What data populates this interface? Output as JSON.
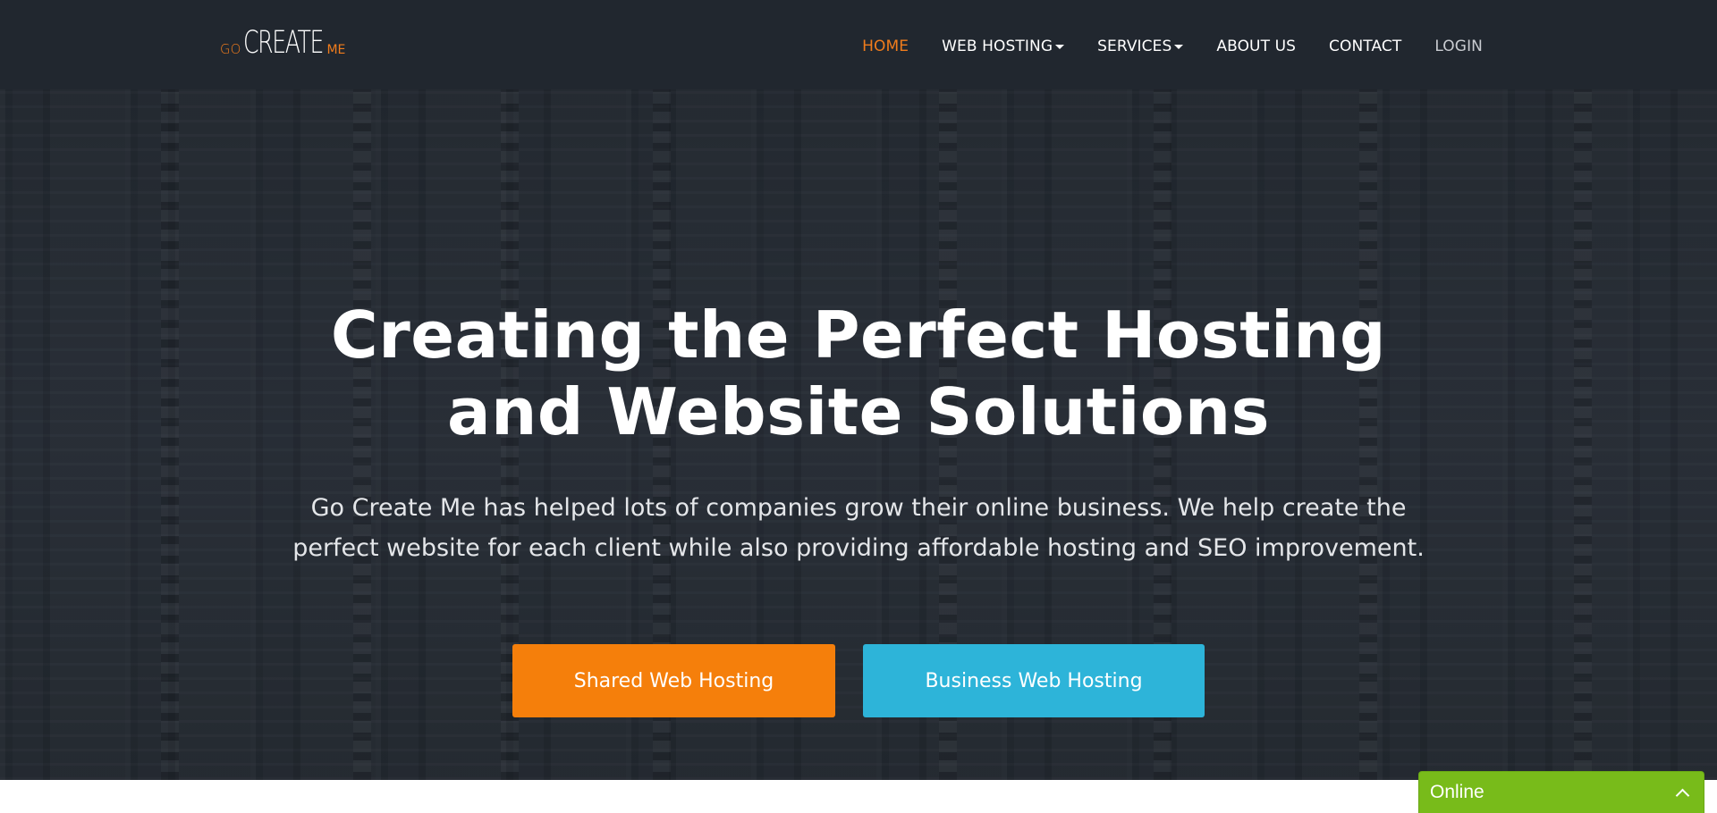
{
  "logo": {
    "go": "GO",
    "create": "CREATE",
    "me": "ME"
  },
  "nav": {
    "home": "HOME",
    "web_hosting": "WEB HOSTING",
    "services": "SERVICES",
    "about_us": "ABOUT US",
    "contact": "CONTACT",
    "login": "LOGIN"
  },
  "hero": {
    "title_line1": "Creating the Perfect Hosting",
    "title_line2": "and Website Solutions",
    "subtitle": "Go Create Me has helped lots of companies grow their online business. We help create the perfect website for each client while also providing affordable hosting and SEO improvement.",
    "buttons": {
      "shared": "Shared Web Hosting",
      "business": "Business Web Hosting"
    }
  },
  "chat": {
    "label": "Online",
    "icon": "chevron-up-icon"
  },
  "colors": {
    "navbar_bg": "#21272f",
    "accent_orange": "#f57f0b",
    "accent_blue": "#2db4d9",
    "chat_green": "#78bb1a"
  }
}
